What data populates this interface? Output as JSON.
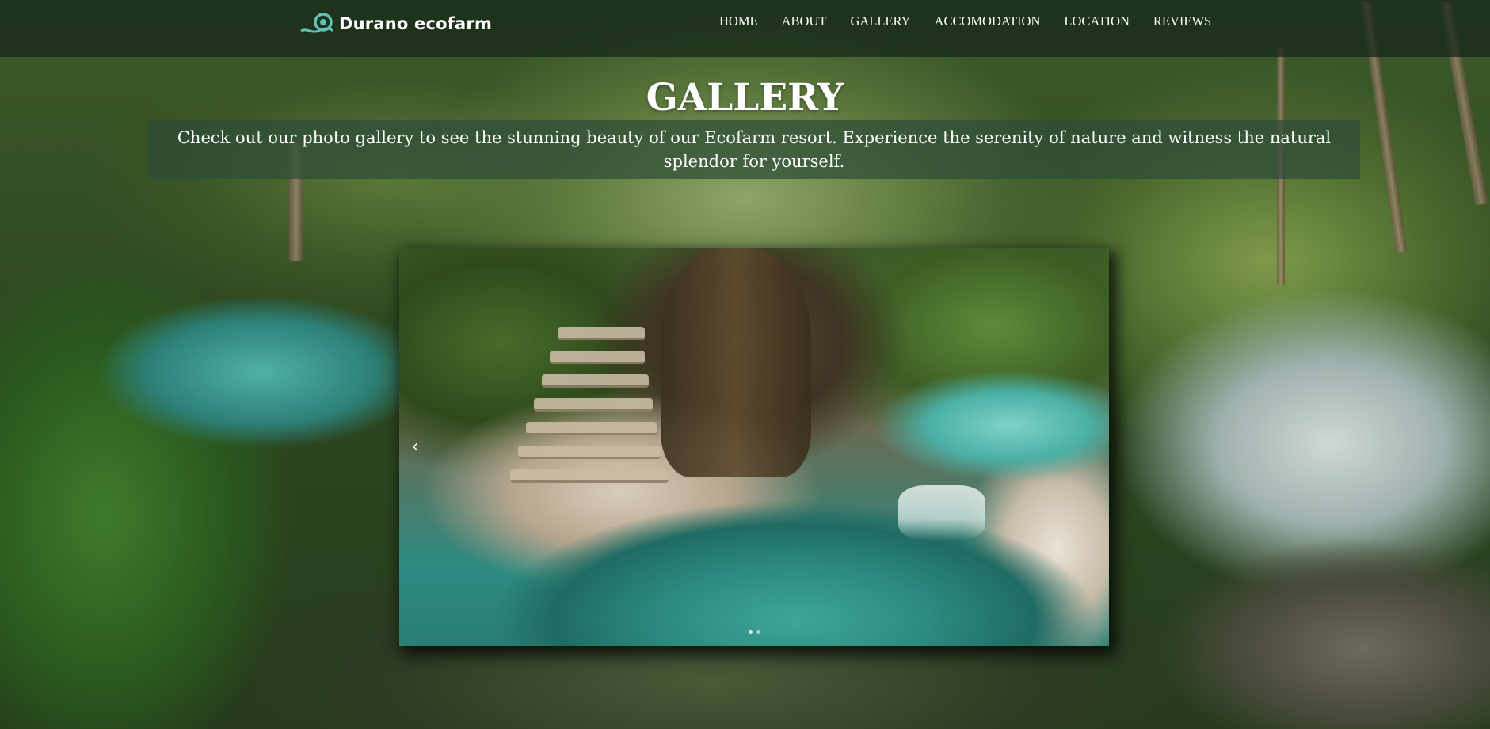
{
  "brand": {
    "name": "Durano ecofarm",
    "logo_icon": "wave-logo-icon",
    "accent_color": "#5fc2b4"
  },
  "nav": {
    "items": [
      "HOME",
      "ABOUT",
      "GALLERY",
      "ACCOMODATION",
      "LOCATION",
      "REVIEWS"
    ]
  },
  "hero": {
    "title": "GALLERY",
    "description": "Check out our photo gallery to see the stunning beauty of our Ecofarm resort. Experience the serenity of nature and witness the natural splendor for yourself."
  },
  "carousel": {
    "prev_icon": "chevron-left-icon",
    "prev_symbol": "‹",
    "indicator_count": 2,
    "active_index": 0
  }
}
